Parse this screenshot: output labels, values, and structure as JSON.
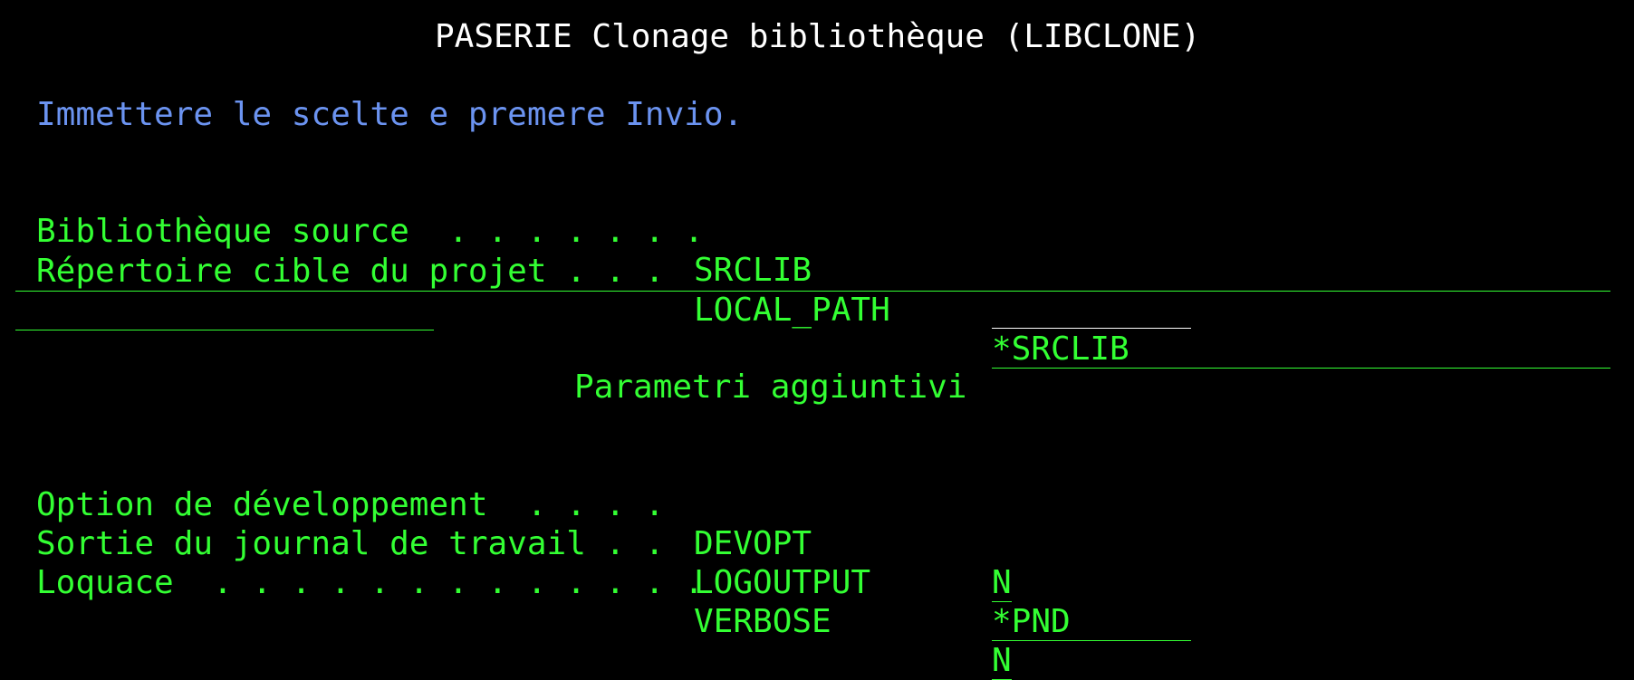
{
  "screen": {
    "title": "PASERIE Clonage bibliothèque (LIBCLONE)",
    "instruction": "Immettere le scelte e premere Invio.",
    "section_title": "Parametri aggiuntivi"
  },
  "params": [
    {
      "label": "Bibliothèque source  . . . . . . .",
      "keyword": "SRCLIB",
      "value": ""
    },
    {
      "label": "Répertoire cible du projet . . .",
      "keyword": "LOCAL_PATH",
      "value": "*SRCLIB"
    }
  ],
  "extra_params": [
    {
      "label": "Option de développement  . . . .",
      "keyword": "DEVOPT",
      "value": "N"
    },
    {
      "label": "Sortie du journal de travail . .",
      "keyword": "LOGOUTPUT",
      "value": "*PND"
    },
    {
      "label": "Loquace  . . . . . . . . . . . . .",
      "keyword": "VERBOSE",
      "value": "N"
    }
  ],
  "colors": {
    "background": "#000000",
    "title": "#ffffff",
    "instruction": "#6b93f0",
    "field_text": "#33ff33"
  }
}
